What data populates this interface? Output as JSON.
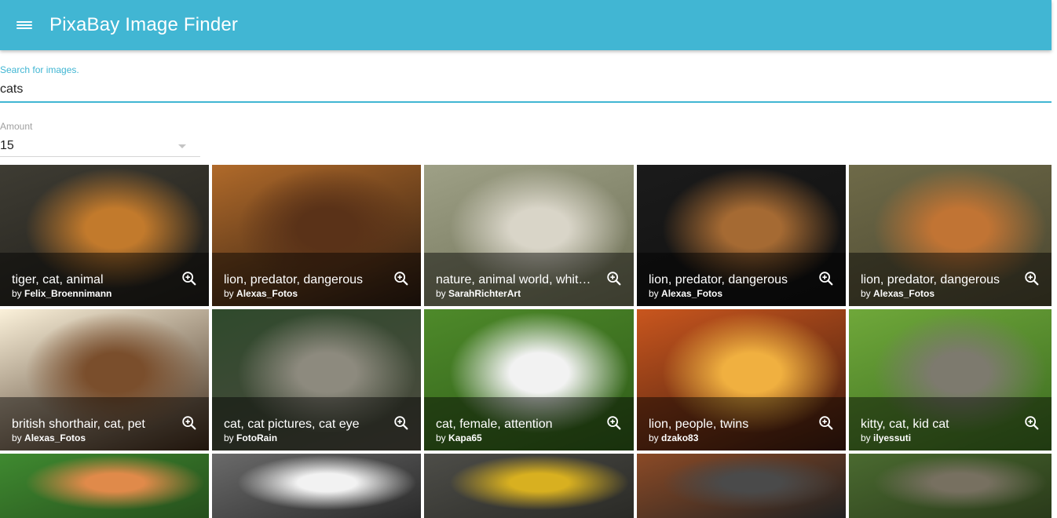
{
  "appbar": {
    "title": "PixaBay Image Finder",
    "menu_icon": "menu-icon",
    "color": "#41b6d3"
  },
  "search": {
    "label": "Search for images.",
    "value": "cats"
  },
  "amount": {
    "label": "Amount",
    "value": "15"
  },
  "images": [
    {
      "title": "tiger, cat, animal",
      "by": "by",
      "author": "Felix_Broennimann",
      "colors": [
        "#3e3c33",
        "#c27a2c",
        "#1e1c18"
      ]
    },
    {
      "title": "lion, predator, dangerous",
      "by": "by",
      "author": "Alexas_Fotos",
      "colors": [
        "#b06a2a",
        "#5a3218",
        "#2a1a10"
      ]
    },
    {
      "title": "nature, animal world, whit…",
      "by": "by",
      "author": "SarahRichterArt",
      "colors": [
        "#9ea086",
        "#d9d5c8",
        "#6d6f55"
      ]
    },
    {
      "title": "lion, predator, dangerous",
      "by": "by",
      "author": "Alexas_Fotos",
      "colors": [
        "#1b1b1b",
        "#a56a33",
        "#0f0f0f"
      ]
    },
    {
      "title": "lion, predator, dangerous",
      "by": "by",
      "author": "Alexas_Fotos",
      "colors": [
        "#6e6a48",
        "#c17434",
        "#4a4630"
      ]
    },
    {
      "title": "british shorthair, cat, pet",
      "by": "by",
      "author": "Alexas_Fotos",
      "colors": [
        "#fbf1da",
        "#7a4e2c",
        "#3c2818"
      ]
    },
    {
      "title": "cat, cat pictures, cat eye",
      "by": "by",
      "author": "FotoRain",
      "colors": [
        "#2f4a2c",
        "#8d8a7e",
        "#4d4a40"
      ]
    },
    {
      "title": "cat, female, attention",
      "by": "by",
      "author": "Kapa65",
      "colors": [
        "#4e8a2a",
        "#f2f2f2",
        "#2e5a18"
      ]
    },
    {
      "title": "lion, people, twins",
      "by": "by",
      "author": "dzako83",
      "colors": [
        "#c9561e",
        "#f0b040",
        "#3a1a0e"
      ]
    },
    {
      "title": "kitty, cat, kid cat",
      "by": "by",
      "author": "ilyessuti",
      "colors": [
        "#6fa83a",
        "#7d7a6e",
        "#3b6a20"
      ]
    },
    {
      "title": "",
      "by": "",
      "author": "",
      "colors": [
        "#3f8a30",
        "#e08a4a",
        "#264f1c"
      ]
    },
    {
      "title": "",
      "by": "",
      "author": "",
      "colors": [
        "#6a6a6a",
        "#f2f2f2",
        "#2b2b2b"
      ]
    },
    {
      "title": "",
      "by": "",
      "author": "",
      "colors": [
        "#4d4d48",
        "#d8b020",
        "#2a2a26"
      ]
    },
    {
      "title": "",
      "by": "",
      "author": "",
      "colors": [
        "#8b4a26",
        "#4a4a4a",
        "#222222"
      ]
    },
    {
      "title": "",
      "by": "",
      "author": "",
      "colors": [
        "#4a6a30",
        "#777060",
        "#2a3a1a"
      ]
    }
  ]
}
